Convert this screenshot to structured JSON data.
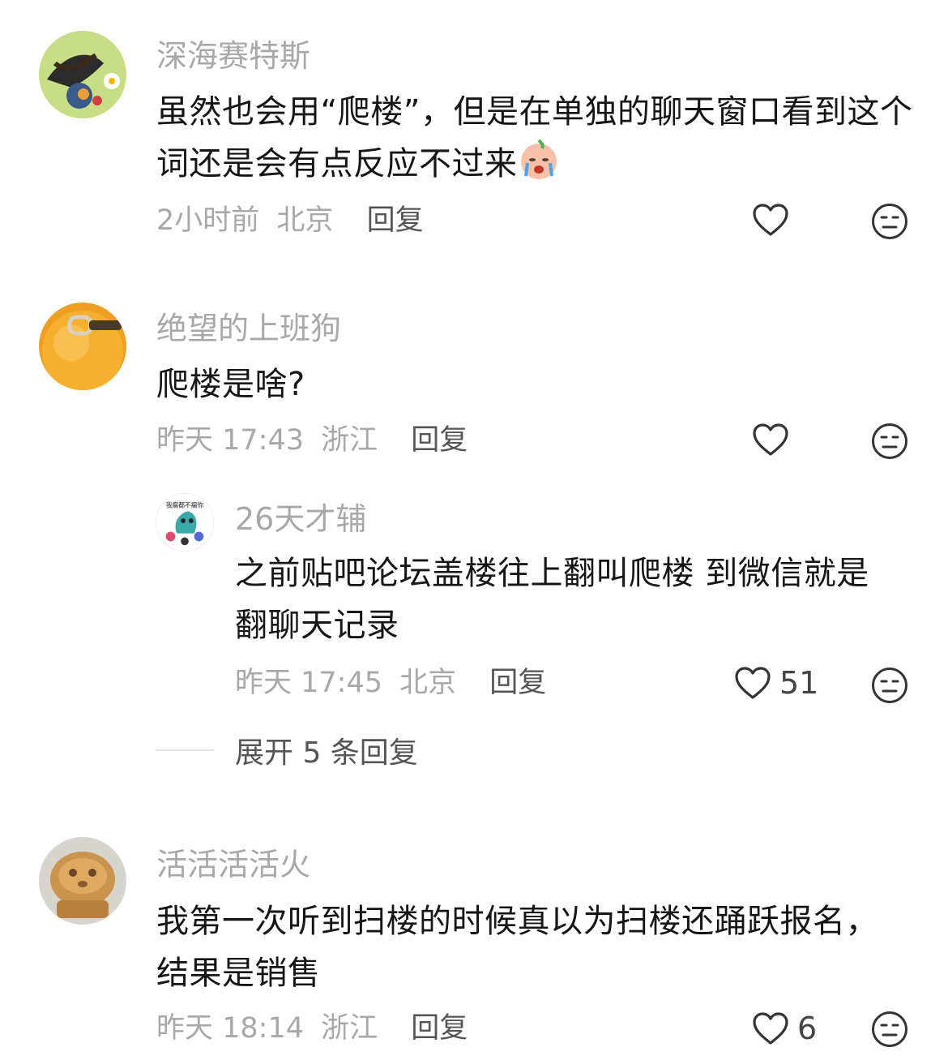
{
  "comments": [
    {
      "username": "深海赛特斯",
      "text": "虽然也会用“爬楼”，但是在单独的聊天窗口看到这个词还是会有点反应不过来",
      "emoji": "crying-face-emoji",
      "time": "2小时前",
      "location": "北京",
      "reply_label": "回复",
      "likes": ""
    },
    {
      "username": "绝望的上班狗",
      "text": "爬楼是啥?",
      "time": "昨天 17:43",
      "location": "浙江",
      "reply_label": "回复",
      "likes": ""
    },
    {
      "username": "26天才辅",
      "avatar_text": "我瘸都不瘸你",
      "text": "之前贴吧论坛盖楼往上翻叫爬楼 到微信就是翻聊天记录",
      "time": "昨天 17:45",
      "location": "北京",
      "reply_label": "回复",
      "likes": "51"
    },
    {
      "username": "活活活活火",
      "text": "我第一次听到扫楼的时候真以为扫楼还踊跃报名，结果是销售",
      "time": "昨天 18:14",
      "location": "浙江",
      "reply_label": "回复",
      "likes": "6"
    }
  ],
  "expand_replies": "展开 5 条回复",
  "icons": {
    "like": "heart-outline-icon",
    "dislike": "meh-face-icon"
  },
  "colors": {
    "username": "#a8a8a8",
    "meta": "#a8a8a8",
    "reply": "#555555",
    "text": "#161616"
  }
}
